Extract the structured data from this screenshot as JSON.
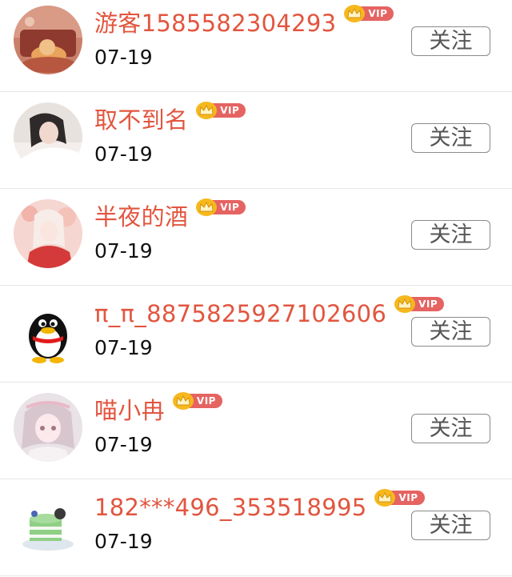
{
  "rows": [
    {
      "name": "游客1585582304293",
      "date": "07-19",
      "badge": "VIP",
      "follow_label": "关注",
      "avatar": "fox-scene-avatar"
    },
    {
      "name": "取不到名",
      "date": "07-19",
      "badge": "VIP",
      "follow_label": "关注",
      "avatar": "girl-portrait-avatar"
    },
    {
      "name": "半夜的酒",
      "date": "07-19",
      "badge": "VIP",
      "follow_label": "关注",
      "avatar": "anime-girl-avatar"
    },
    {
      "name": "π_π_8875825927102606",
      "date": "07-19",
      "badge": "VIP",
      "follow_label": "关注",
      "avatar": "qq-penguin-avatar"
    },
    {
      "name": "喵小冉",
      "date": "07-19",
      "badge": "VIP",
      "follow_label": "关注",
      "avatar": "anime-illustration-avatar"
    },
    {
      "name": "182***496_353518995",
      "date": "07-19",
      "badge": "VIP",
      "follow_label": "关注",
      "avatar": "cake-dessert-avatar"
    }
  ],
  "colors": {
    "name": "#e2553f",
    "vip_tag": "#e56361",
    "crown": "#f6b81e",
    "button_border": "#8a8a8a"
  }
}
